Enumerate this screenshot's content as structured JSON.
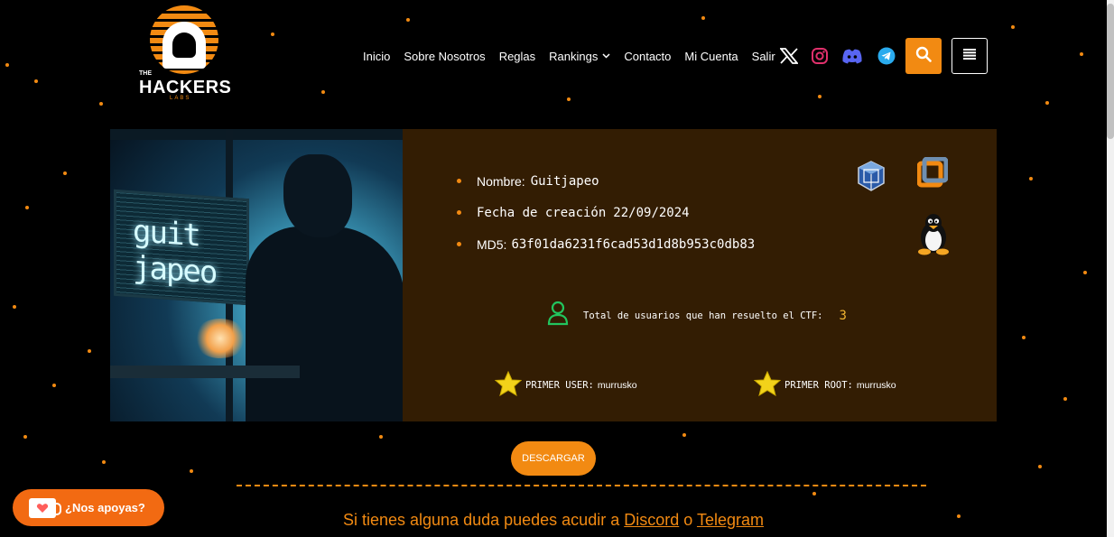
{
  "brand": {
    "the": "THE",
    "name": "HACKERS",
    "labs": "LABS"
  },
  "nav": {
    "items": [
      "Inicio",
      "Sobre Nosotros",
      "Reglas",
      "Rankings",
      "Contacto",
      "Mi Cuenta",
      "Salir"
    ],
    "rankings_chevron": "chevron-down-icon"
  },
  "social": {
    "x": "x-icon",
    "instagram": "instagram-icon",
    "discord": "discord-icon",
    "telegram": "telegram-icon",
    "accent": "#f28a12"
  },
  "ctf": {
    "image_caption": "guit japeo",
    "name_label": "Nombre:",
    "name": "Guitjapeo",
    "date_label": "Fecha de creación",
    "date": "22/09/2024",
    "md5_label": "MD5:",
    "md5": "63f01da6231f6cad53d1d8b953c0db83",
    "total_label": "Total de usuarios que han resuelto el CTF:",
    "total_count": "3",
    "first_user_label": "PRIMER USER:",
    "first_user": "murrusko",
    "first_root_label": "PRIMER ROOT:",
    "first_root": "murrusko",
    "platforms": [
      "virtualbox-icon",
      "vmware-icon",
      "linux-tux-icon"
    ]
  },
  "download_label": "DESCARGAR",
  "help": {
    "prefix": "Si tienes alguna duda puedes acudir a",
    "discord": "Discord",
    "connector": "o",
    "telegram": "Telegram"
  },
  "kofi_label": "¿Nos apoyas?",
  "colors": {
    "orange": "#f28a12",
    "card_bg": "#331d03",
    "gold": "#f2b531",
    "user_icon": "#22c55e"
  }
}
